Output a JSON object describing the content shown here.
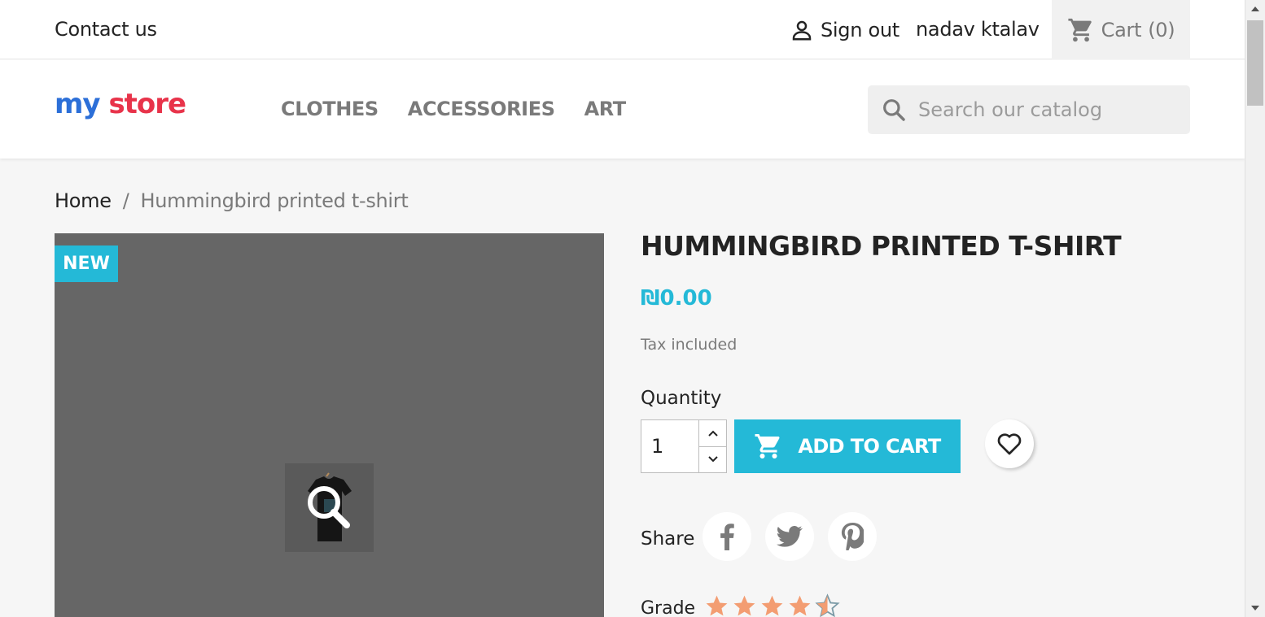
{
  "topbar": {
    "contact": "Contact us",
    "signout": "Sign out",
    "username": "nadav ktalav",
    "cart": "Cart",
    "cart_count": "(0)"
  },
  "header": {
    "logo": {
      "w1": "my",
      "w2": "store"
    },
    "nav": [
      "CLOTHES",
      "ACCESSORIES",
      "ART"
    ],
    "search_placeholder": "Search our catalog"
  },
  "breadcrumb": {
    "home": "Home",
    "sep": "/",
    "current": "Hummingbird printed t-shirt"
  },
  "product": {
    "flag": "NEW",
    "title": "HUMMINGBIRD PRINTED T-SHIRT",
    "price": "₪0.00",
    "tax": "Tax included",
    "quantity_label": "Quantity",
    "quantity_value": "1",
    "add_to_cart": "ADD TO CART",
    "share_label": "Share",
    "grade_label": "Grade",
    "rating": 4.5,
    "rating_max": 5
  },
  "colors": {
    "accent": "#24b9d7",
    "star": "#f39d72",
    "image_bg": "#666666"
  },
  "icons": [
    "person-icon",
    "cart-icon",
    "search-icon",
    "zoom-icon",
    "chevron-up-icon",
    "chevron-down-icon",
    "heart-icon",
    "facebook-icon",
    "twitter-icon",
    "pinterest-icon",
    "star-icon"
  ]
}
